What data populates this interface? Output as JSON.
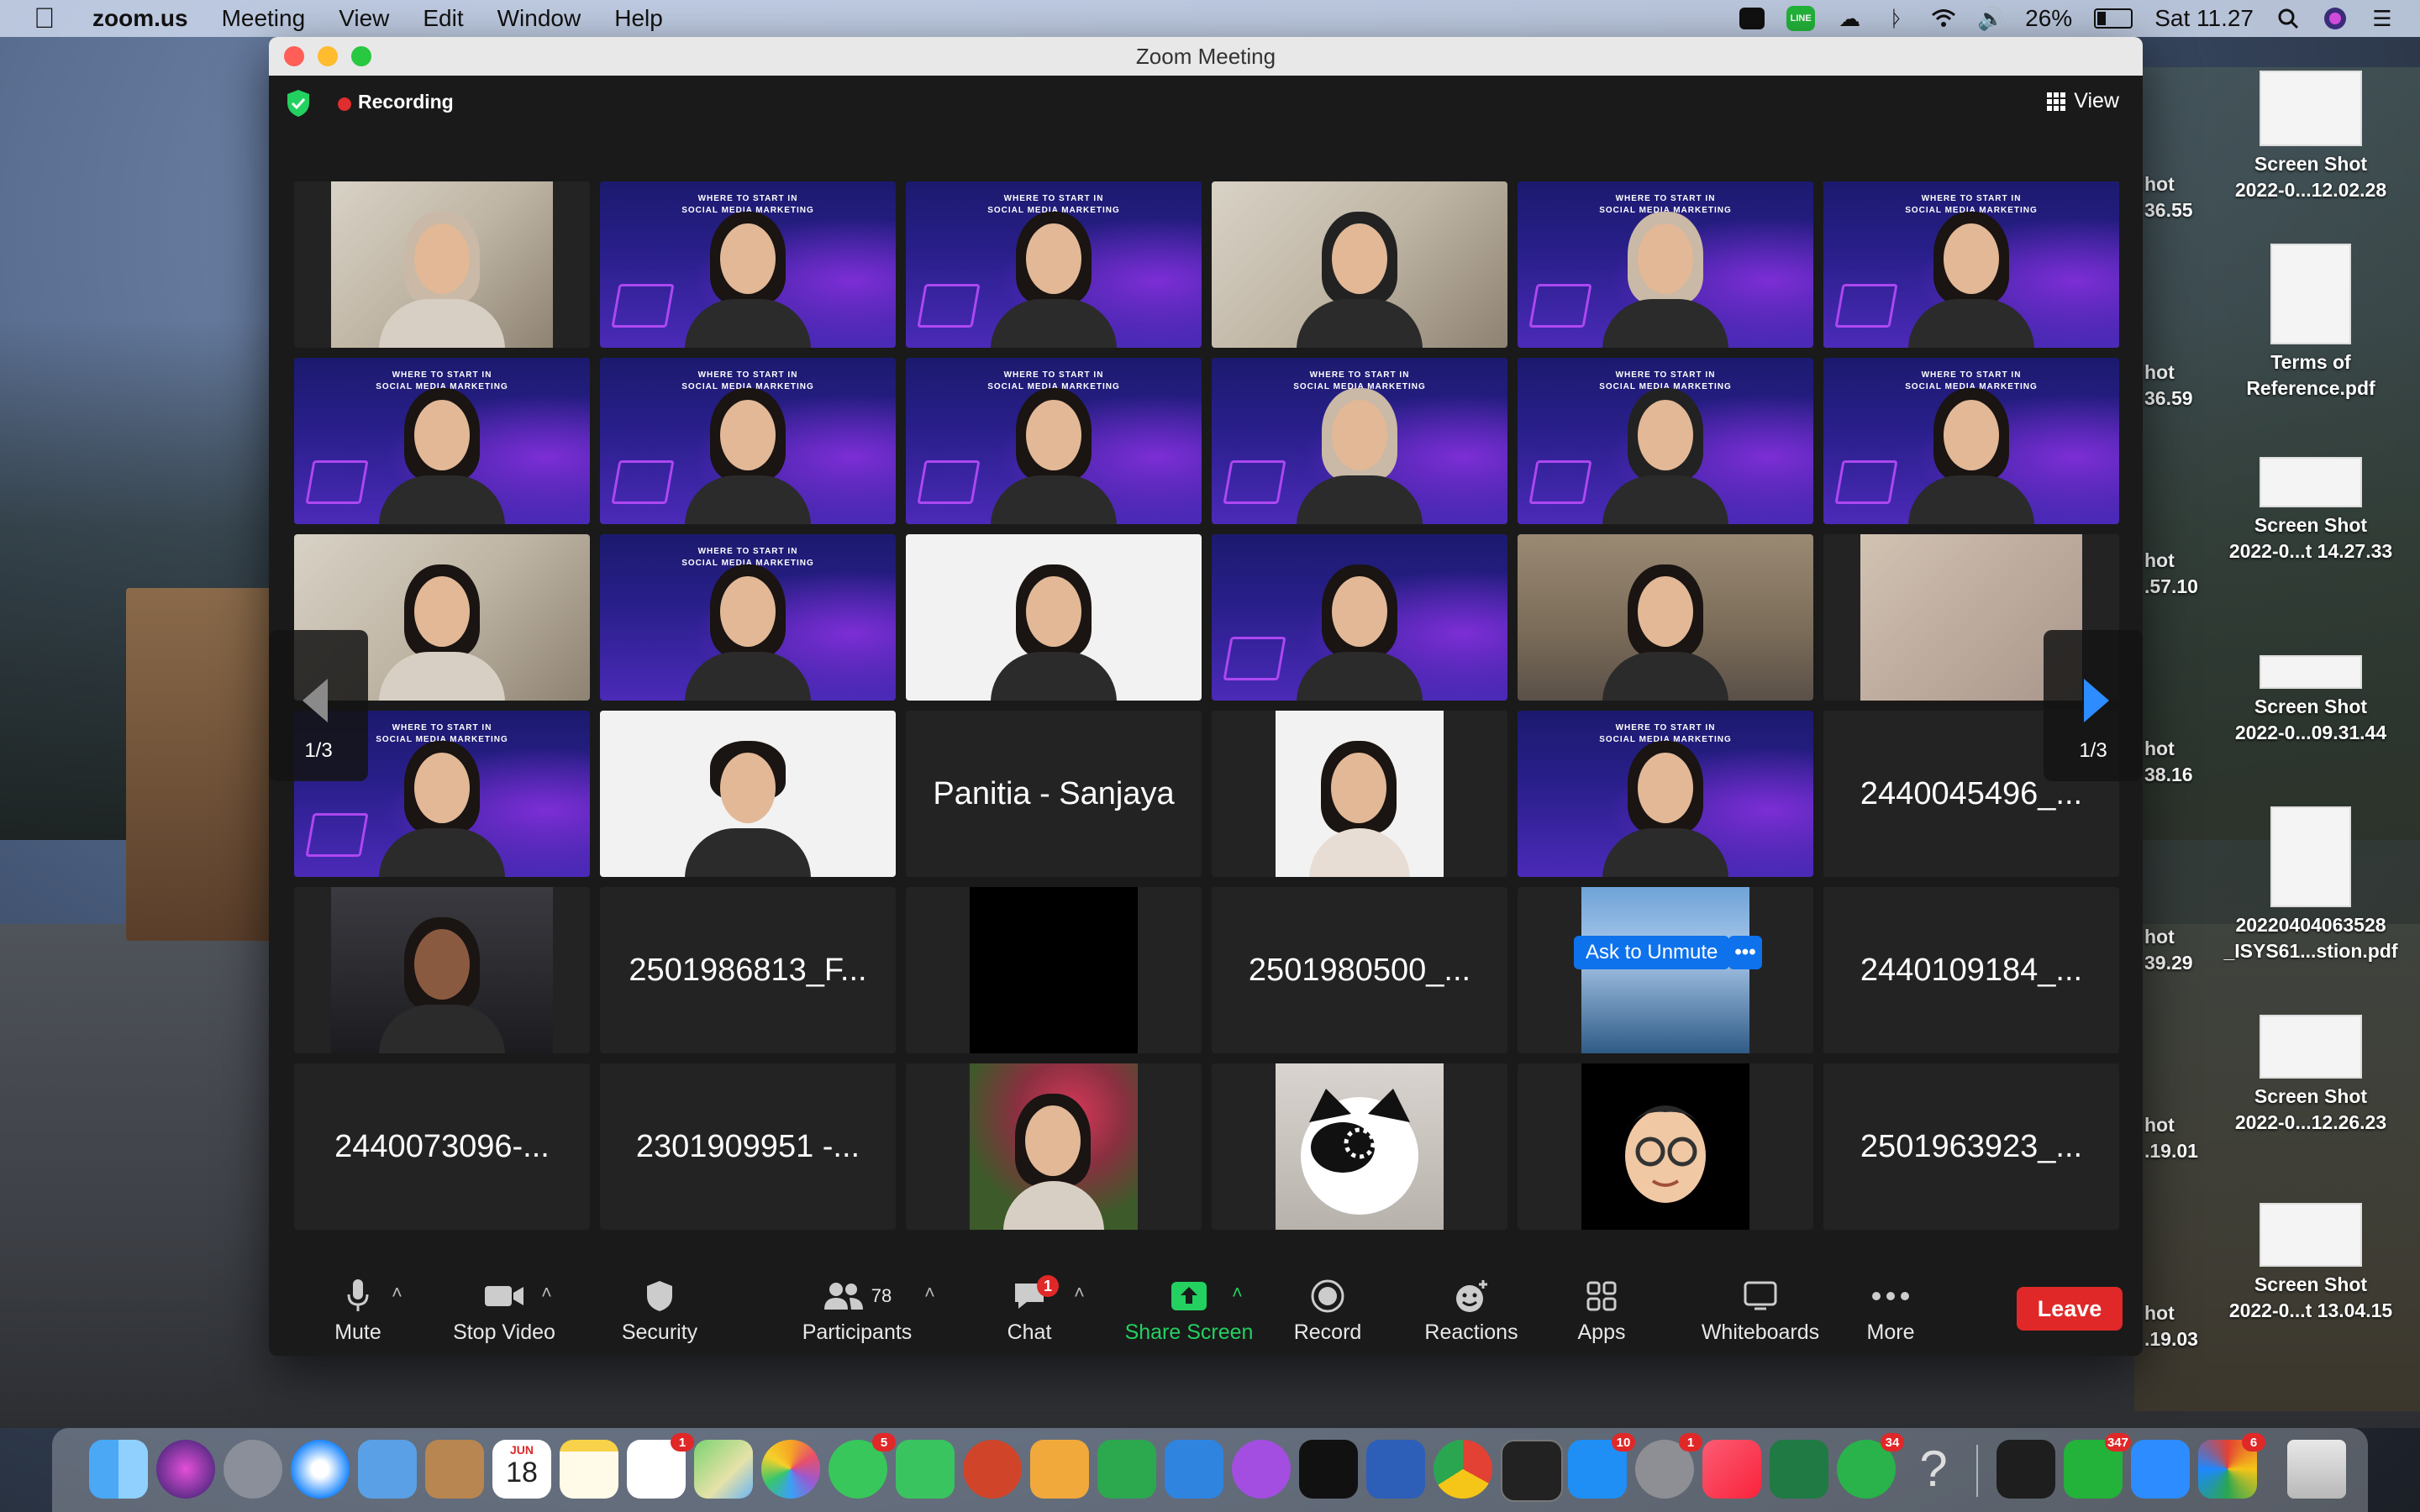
{
  "menubar": {
    "app_name": "zoom.us",
    "menus": [
      "Meeting",
      "View",
      "Edit",
      "Window",
      "Help"
    ],
    "battery": "26%",
    "clock": "Sat 11.27",
    "line_label": "LINE"
  },
  "window": {
    "title": "Zoom Meeting",
    "recording_label": "Recording",
    "view_label": "View"
  },
  "gallery": {
    "page_label_left": "1/3",
    "page_label_right": "1/3",
    "banner_text_line1": "WHERE TO START IN",
    "banner_text_line2": "SOCIAL MEDIA MARKETING",
    "name_tiles": {
      "r4c3": "Panitia - Sanjaya",
      "r4c6": "2440045496_...",
      "r5c2": "2501986813_F...",
      "r5c4": "2501980500_...",
      "r5c6": "2440109184_...",
      "r6c1": "2440073096-...",
      "r6c2": "2301909951 -...",
      "r6c6": "2501963923_..."
    },
    "ask_to_unmute": "Ask to Unmute",
    "more_dots": "•••"
  },
  "toolbar": {
    "mute": "Mute",
    "stop_video": "Stop Video",
    "security": "Security",
    "participants": "Participants",
    "participants_count": "78",
    "chat": "Chat",
    "chat_badge": "1",
    "share_screen": "Share Screen",
    "record": "Record",
    "reactions": "Reactions",
    "apps": "Apps",
    "whiteboards": "Whiteboards",
    "more": "More",
    "leave": "Leave"
  },
  "desktop_icons": [
    {
      "line1": "Screen Shot",
      "line2": "2022-0...12.02.28"
    },
    {
      "line1": "Terms of",
      "line2": "Reference.pdf"
    },
    {
      "line1": "Screen Shot",
      "line2": "2022-0...t 14.27.33"
    },
    {
      "line1": "Screen Shot",
      "line2": "2022-0...09.31.44"
    },
    {
      "line1": "20220404063528",
      "line2": "_ISYS61...stion.pdf"
    },
    {
      "line1": "Screen Shot",
      "line2": "2022-0...12.26.23"
    },
    {
      "line1": "Screen Shot",
      "line2": "2022-0...t 13.04.15"
    }
  ],
  "desktop_partial": [
    {
      "line1": "hot",
      "line2": "36.55"
    },
    {
      "line1": "hot",
      "line2": "36.59"
    },
    {
      "line1": "hot",
      "line2": ".57.10"
    },
    {
      "line1": "hot",
      "line2": "38.16"
    },
    {
      "line1": "hot",
      "line2": "39.29"
    },
    {
      "line1": "hot",
      "line2": ".19.01"
    },
    {
      "line1": "hot",
      "line2": ".19.03"
    }
  ],
  "dock": {
    "calendar_month": "JUN",
    "calendar_day": "18",
    "badges": {
      "reminders": "1",
      "messages": "5",
      "appstore": "10",
      "settings": "1",
      "whatsapp": "34",
      "line": "347",
      "extra": "6"
    }
  },
  "colors": {
    "accent_blue": "#0e72ed",
    "speaking_green": "#23d160",
    "leave_red": "#e02828"
  }
}
